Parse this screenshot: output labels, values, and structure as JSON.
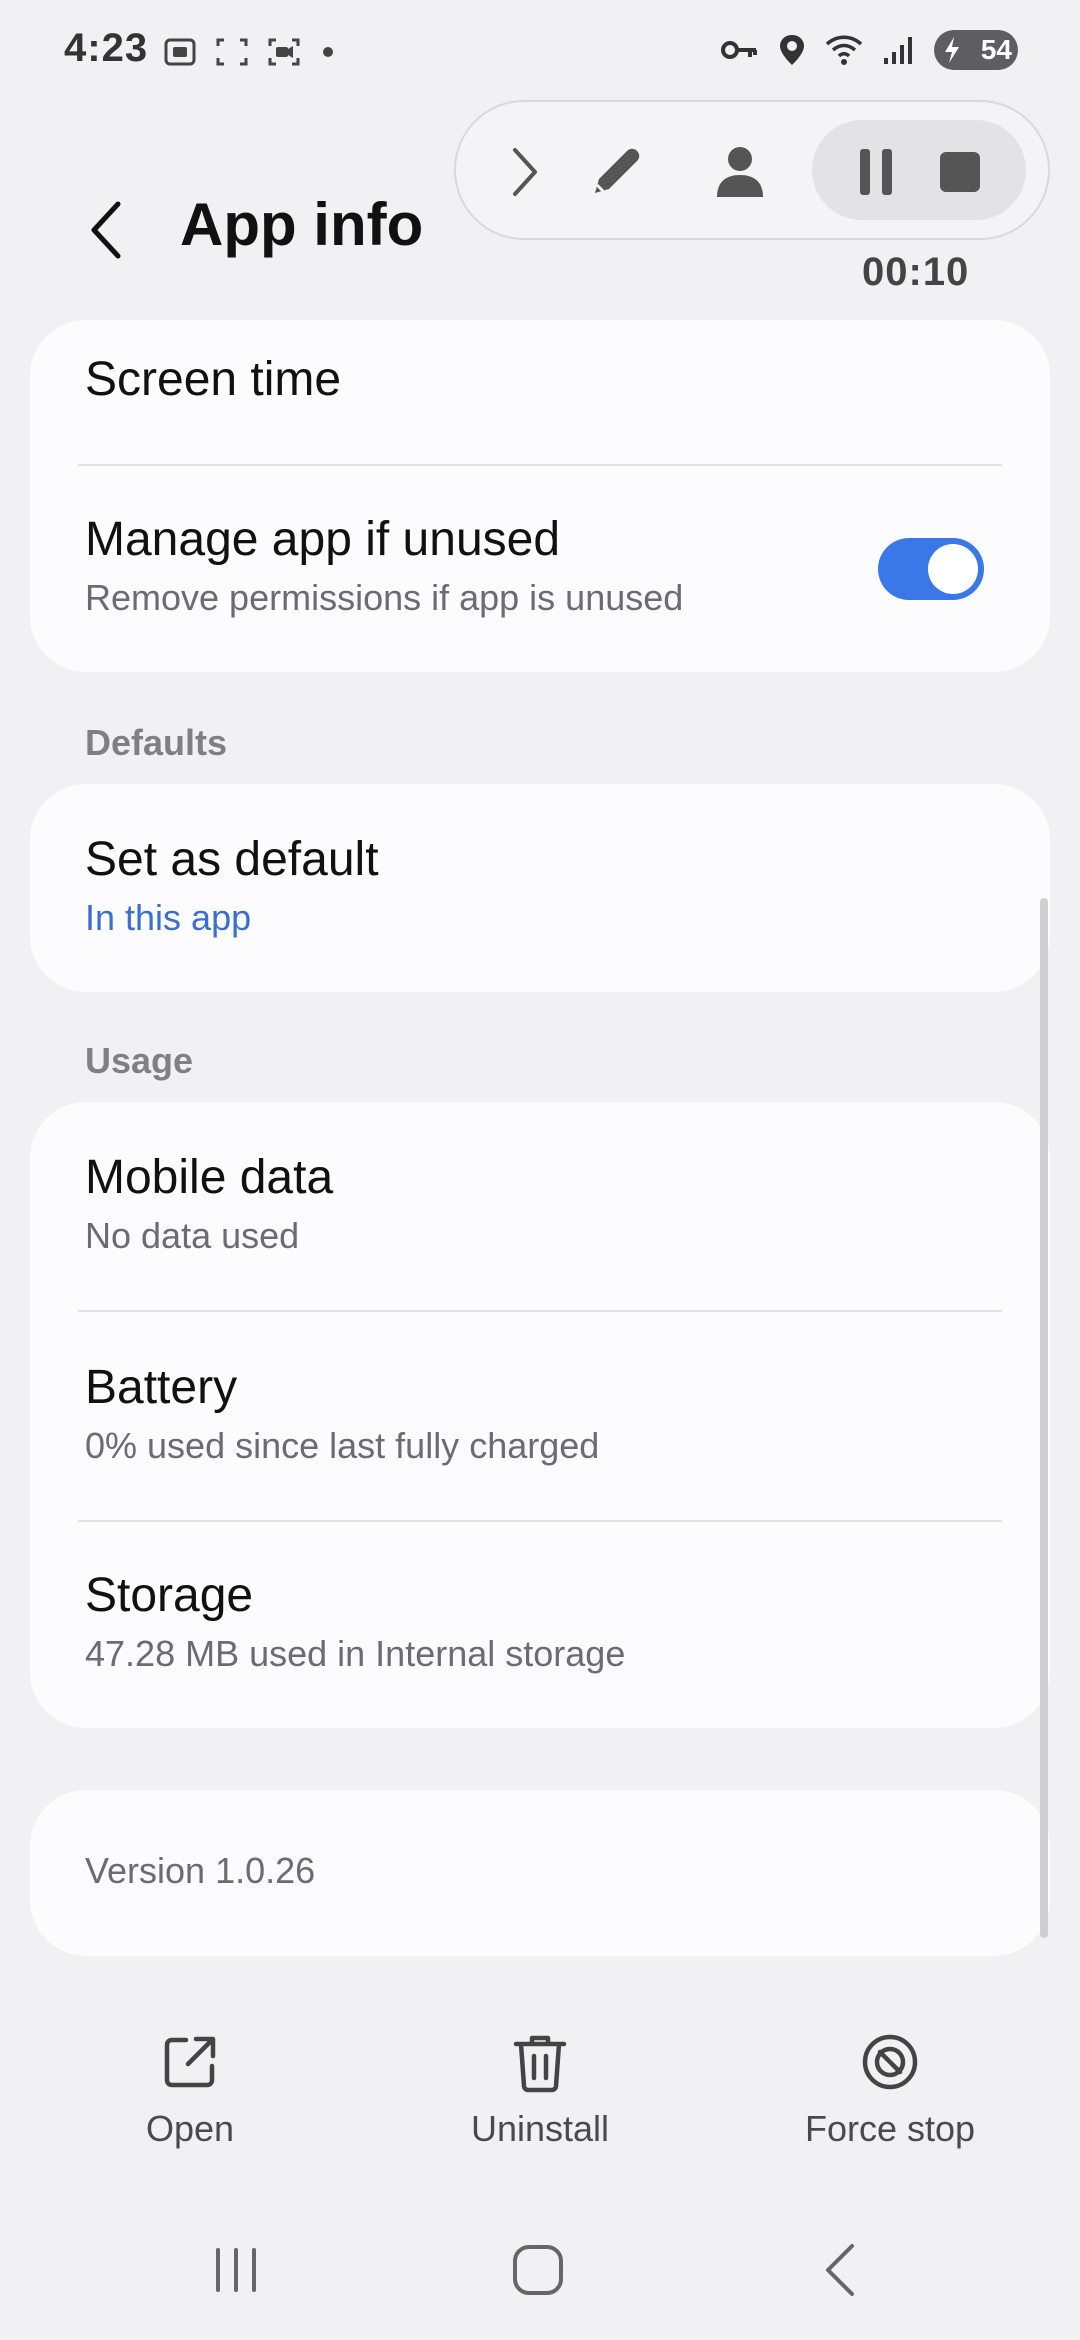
{
  "status_bar": {
    "time": "4:23",
    "left_icons": [
      "screenshot-icon",
      "scan-frame-icon",
      "video-record-icon",
      "dot-icon"
    ],
    "right_icons": [
      "vpn-key-icon",
      "location-icon",
      "wifi-icon",
      "signal-icon"
    ],
    "battery": "54"
  },
  "header": {
    "title": "App info"
  },
  "recorder": {
    "timer": "00:10"
  },
  "card1": {
    "screen_time": "Screen time",
    "manage_title": "Manage app if unused",
    "manage_sub": "Remove permissions if app is unused",
    "manage_toggle_on": true
  },
  "defaults": {
    "header": "Defaults",
    "set_default_title": "Set as default",
    "set_default_sub": "In this app"
  },
  "usage": {
    "header": "Usage",
    "mobile_title": "Mobile data",
    "mobile_sub": "No data used",
    "battery_title": "Battery",
    "battery_sub": "0% used since last fully charged",
    "storage_title": "Storage",
    "storage_sub": "47.28 MB used in Internal storage"
  },
  "version": {
    "text": "Version 1.0.26"
  },
  "actions": {
    "open": "Open",
    "uninstall": "Uninstall",
    "force_stop": "Force stop"
  },
  "colors": {
    "accent": "#3a78e8",
    "link": "#3a6fd0",
    "background": "#f1f1f3",
    "card": "#fcfcfe"
  }
}
